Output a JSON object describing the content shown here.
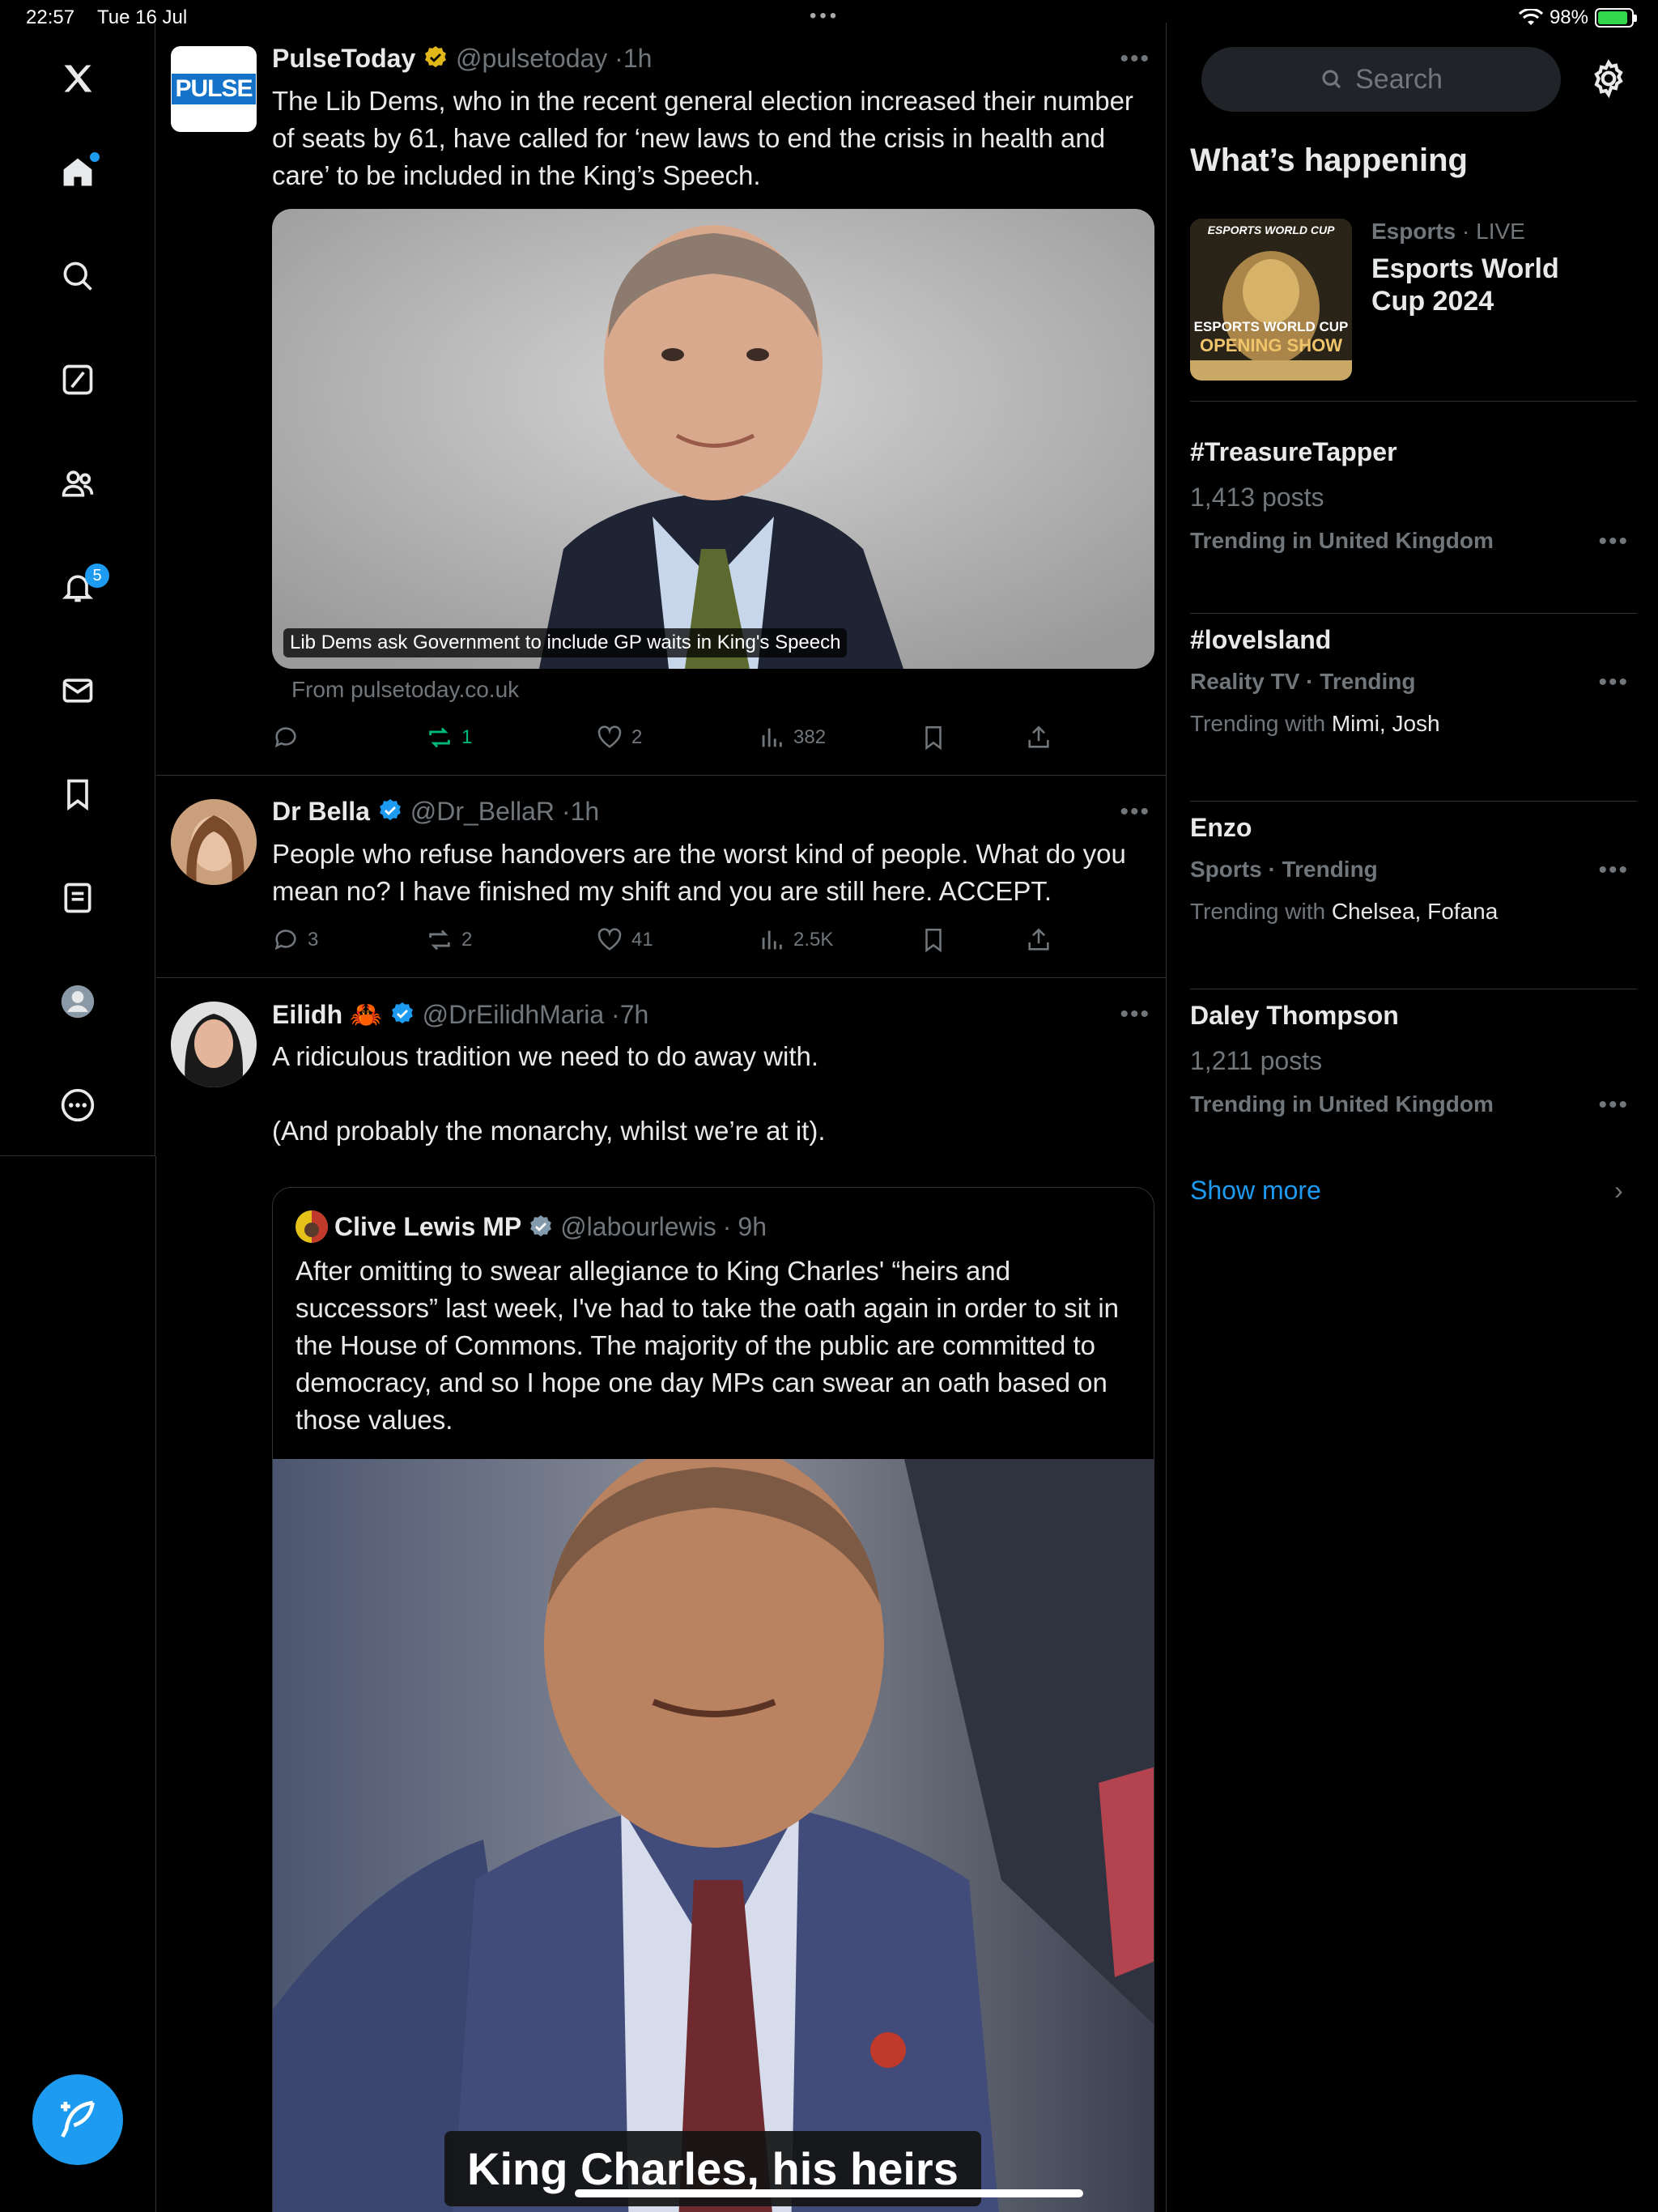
{
  "status": {
    "time": "22:57",
    "date": "Tue 16 Jul",
    "battery": "98%"
  },
  "nav": {
    "notification_count": "5"
  },
  "search": {
    "placeholder": "Search"
  },
  "feed": {
    "tweets": [
      {
        "name": "PulseToday",
        "handle": "@pulsetoday",
        "time": "1h",
        "avatar_text": "PULSE",
        "text": "The Lib Dems, who in the recent general election increased their number of seats by 61, have called for ‘new laws to end the crisis in health and care’ to be included in the King’s Speech.",
        "card_caption": "Lib Dems ask Government to include GP waits in King's Speech",
        "card_source": "From pulsetoday.co.uk",
        "replies": "",
        "reposts": "1",
        "likes": "2",
        "views": "382"
      },
      {
        "name": "Dr Bella",
        "handle": "@Dr_BellaR",
        "time": "1h",
        "text": "People who refuse handovers are the worst kind of people. What do you mean no? I have finished my shift and you are still here. ACCEPT.",
        "replies": "3",
        "reposts": "2",
        "likes": "41",
        "views": "2.5K"
      },
      {
        "name": "Eilidh",
        "name_emoji": "🦀",
        "handle": "@DrEilidhMaria",
        "time": "7h",
        "text_line1": "A ridiculous tradition we need to do away with.",
        "text_line2": "(And probably the monarchy, whilst we’re at it).",
        "quote": {
          "name": "Clive Lewis MP",
          "handle": "@labourlewis",
          "time": "9h",
          "text": "After omitting to swear allegiance to King Charles' “heirs and successors” last week, I've had to take the oath again in order to sit in the House of Commons. The majority of the public are committed to democracy, and so I hope one day MPs can swear an oath based on those values.",
          "subtitle": "King Charles, his heirs"
        }
      }
    ]
  },
  "sidebar": {
    "title": "What’s happening",
    "featured": {
      "category": "Esports",
      "live": "LIVE",
      "title": "Esports World Cup 2024",
      "thumb_top": "ESPORTS WORLD CUP",
      "thumb_line1": "ESPORTS WORLD CUP",
      "thumb_line2": "OPENING SHOW"
    },
    "trends": [
      {
        "title": "#TreasureTapper",
        "line2": "1,413 posts",
        "line3": "Trending in United Kingdom"
      },
      {
        "title": "#loveIsland",
        "line2": "Reality TV · Trending",
        "with_label": "Trending with",
        "with_names": "Mimi, Josh"
      },
      {
        "title": "Enzo",
        "line2": "Sports · Trending",
        "with_label": "Trending with",
        "with_names": "Chelsea, Fofana"
      },
      {
        "title": "Daley Thompson",
        "line2": "1,211 posts",
        "line3": "Trending in United Kingdom"
      }
    ],
    "show_more": "Show more"
  },
  "colors": {
    "accent": "#1d9bf0",
    "repost_active": "#00ba7c",
    "border": "#2f3336",
    "muted": "#71767b"
  }
}
